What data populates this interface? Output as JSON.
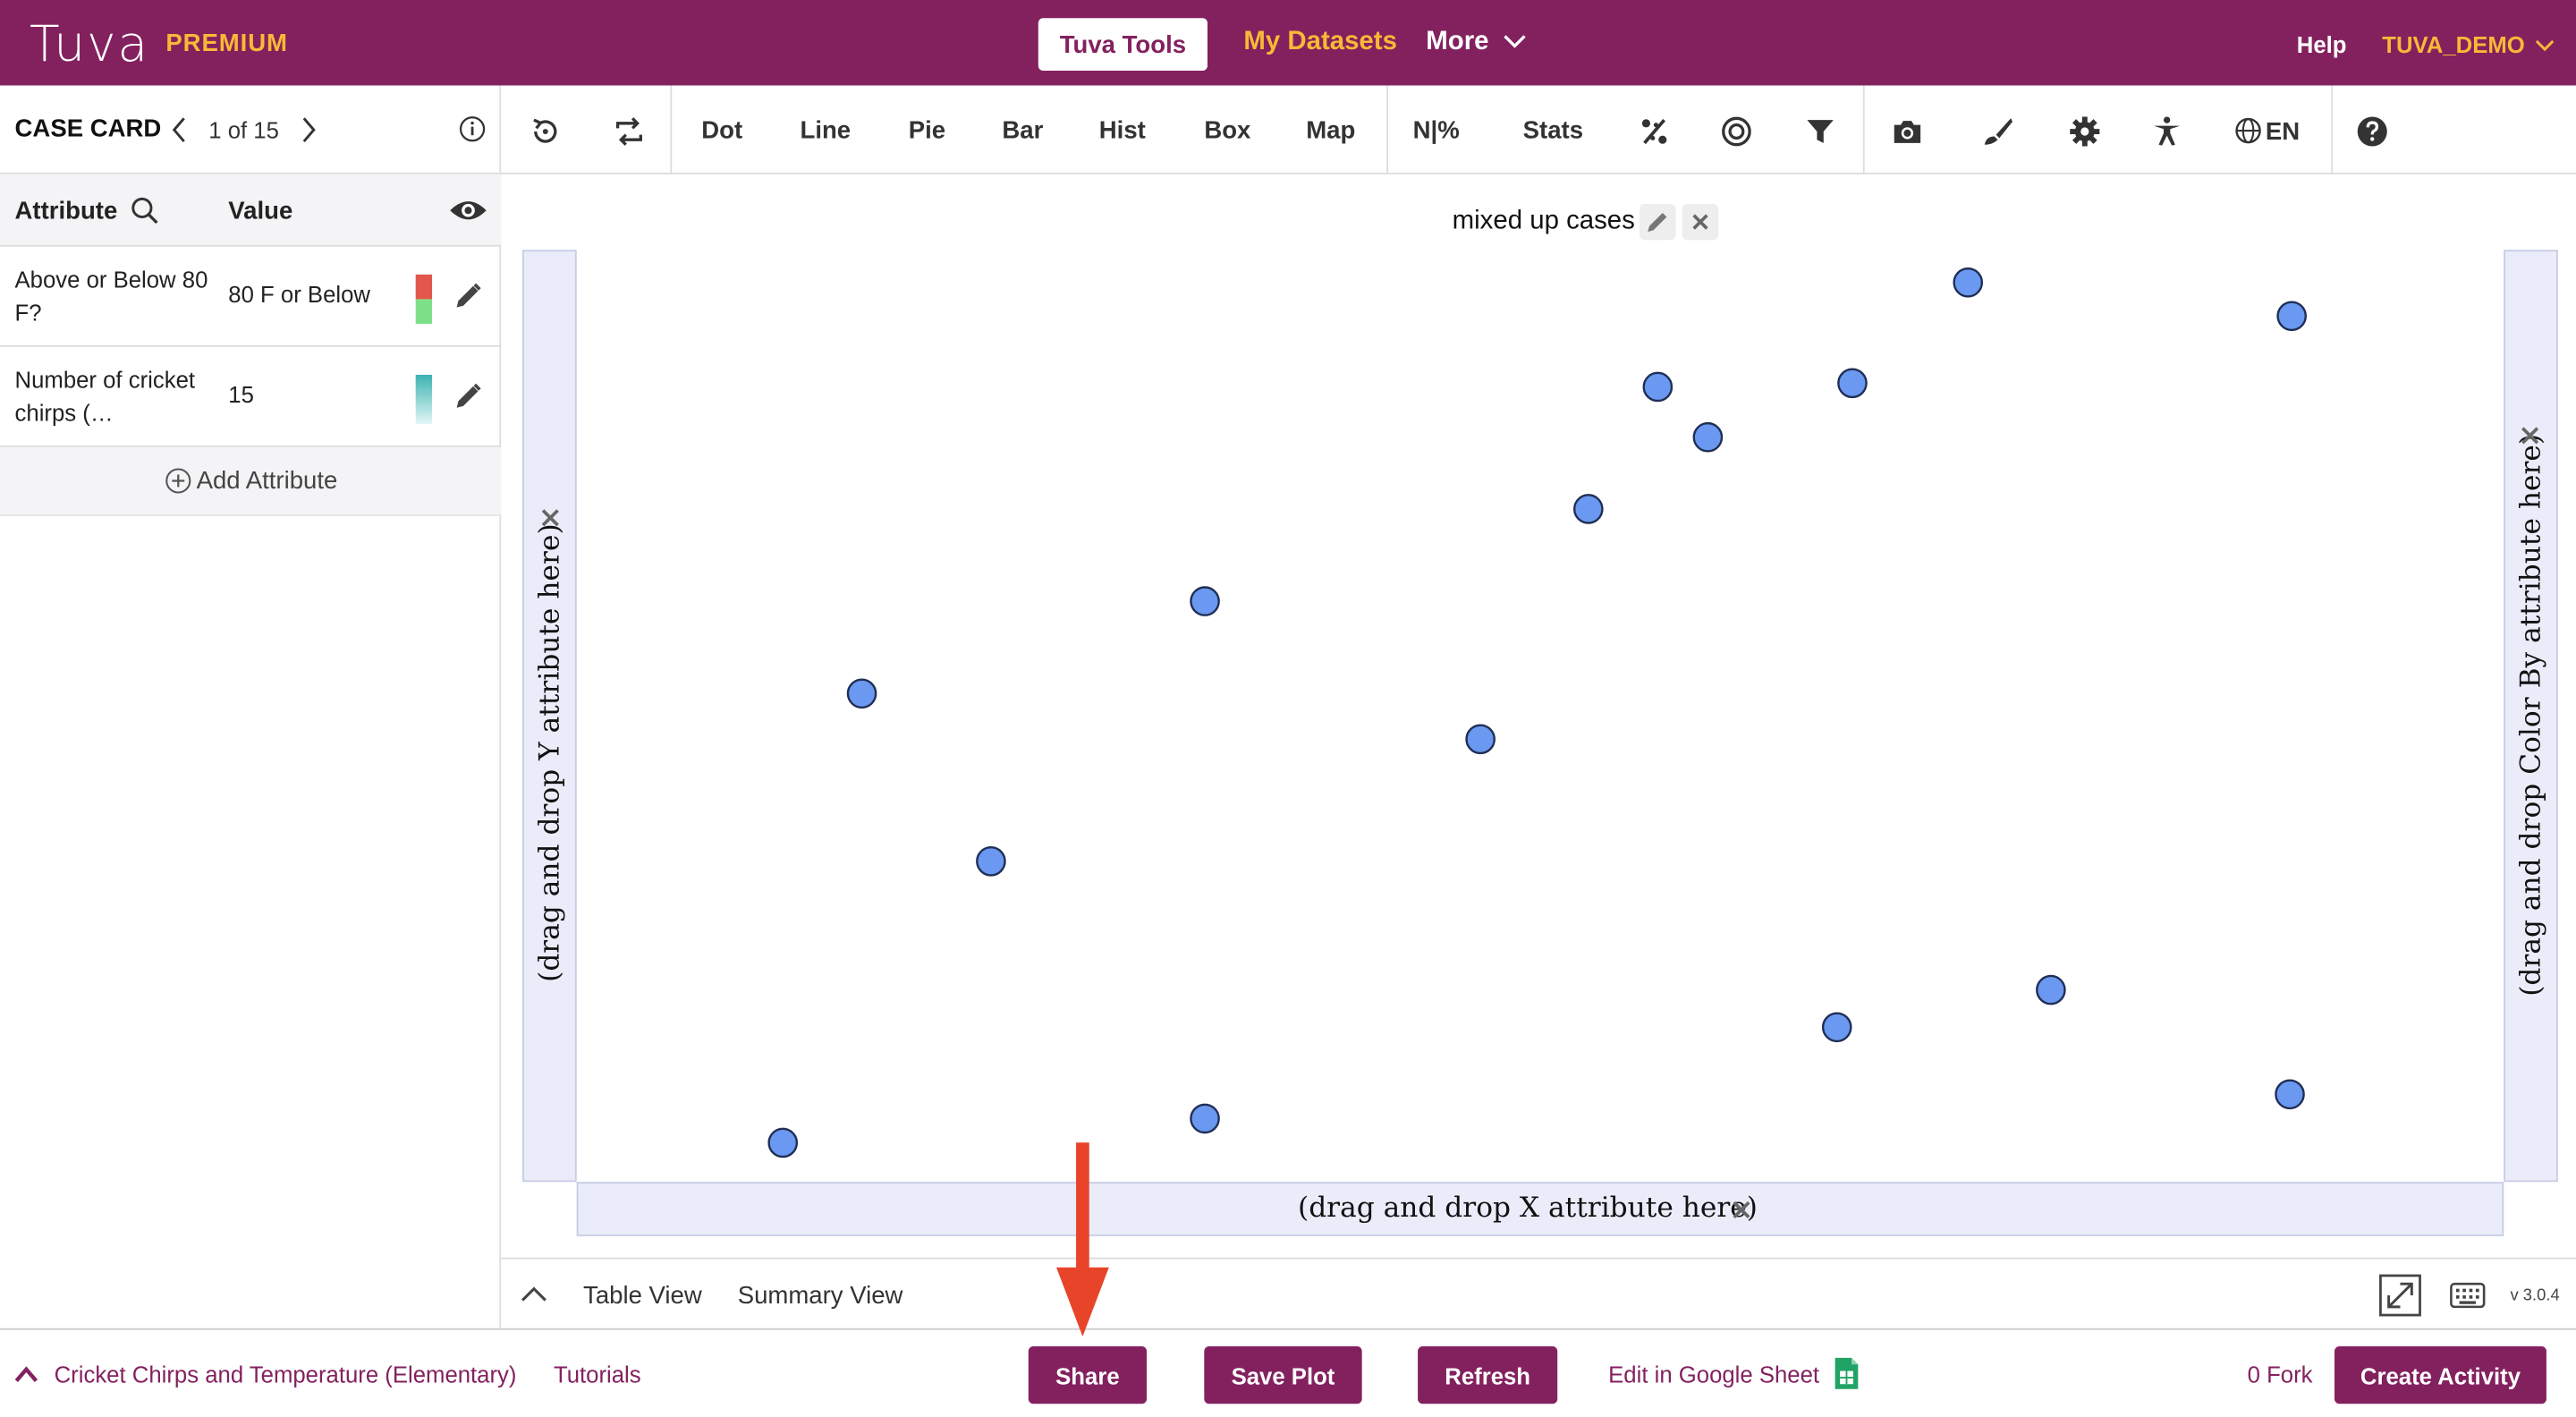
{
  "header": {
    "logo": "Tuva",
    "logo_badge": "PREMIUM",
    "tools_button": "Tuva Tools",
    "nav_datasets": "My Datasets",
    "nav_more": "More",
    "nav_help": "Help",
    "nav_user": "TUVA_DEMO"
  },
  "case_card": {
    "title": "CASE CARD",
    "counter": "1 of 15",
    "attribute_header": "Attribute",
    "value_header": "Value",
    "rows": [
      {
        "name": "Above or Below 80 F?",
        "value": "80 F or Below"
      },
      {
        "name": "Number of cricket chirps (…",
        "value": "15"
      }
    ],
    "add_attribute": "Add Attribute"
  },
  "toolbar": {
    "dot": "Dot",
    "line": "Line",
    "pie": "Pie",
    "bar": "Bar",
    "hist": "Hist",
    "box": "Box",
    "map": "Map",
    "n_percent": "N|%",
    "stats": "Stats",
    "language": "EN"
  },
  "plot": {
    "title": "mixed up cases",
    "y_drop": "(drag and drop Y attribute here)",
    "x_drop": "(drag and drop X attribute here)",
    "color_drop": "(drag and drop Color By attribute here)"
  },
  "chart_data": {
    "type": "scatter",
    "title": "mixed up cases",
    "xlabel": "",
    "ylabel": "",
    "xlim": [
      0,
      1
    ],
    "ylim": [
      0,
      1
    ],
    "grid": false,
    "point_color": "#6b98f0",
    "points": [
      {
        "x": 0.107,
        "y": 0.042
      },
      {
        "x": 0.148,
        "y": 0.524
      },
      {
        "x": 0.215,
        "y": 0.344
      },
      {
        "x": 0.326,
        "y": 0.623
      },
      {
        "x": 0.326,
        "y": 0.068
      },
      {
        "x": 0.469,
        "y": 0.475
      },
      {
        "x": 0.525,
        "y": 0.722
      },
      {
        "x": 0.561,
        "y": 0.853
      },
      {
        "x": 0.587,
        "y": 0.799
      },
      {
        "x": 0.662,
        "y": 0.857
      },
      {
        "x": 0.654,
        "y": 0.166
      },
      {
        "x": 0.722,
        "y": 0.965
      },
      {
        "x": 0.765,
        "y": 0.206
      },
      {
        "x": 0.889,
        "y": 0.094
      },
      {
        "x": 0.89,
        "y": 0.929
      }
    ]
  },
  "view_bar": {
    "table_view": "Table View",
    "summary_view": "Summary View",
    "version": "v 3.0.4"
  },
  "footer": {
    "dataset": "Cricket Chirps and Temperature (Elementary)",
    "tutorials": "Tutorials",
    "share": "Share",
    "save_plot": "Save Plot",
    "refresh": "Refresh",
    "edit_sheet": "Edit in Google Sheet",
    "fork": "0 Fork",
    "create_activity": "Create Activity"
  },
  "colors": {
    "brand": "#83215f",
    "accent": "#f7b936",
    "drop_zone": "#eaedf9",
    "annotation_arrow": "#e8442a"
  }
}
